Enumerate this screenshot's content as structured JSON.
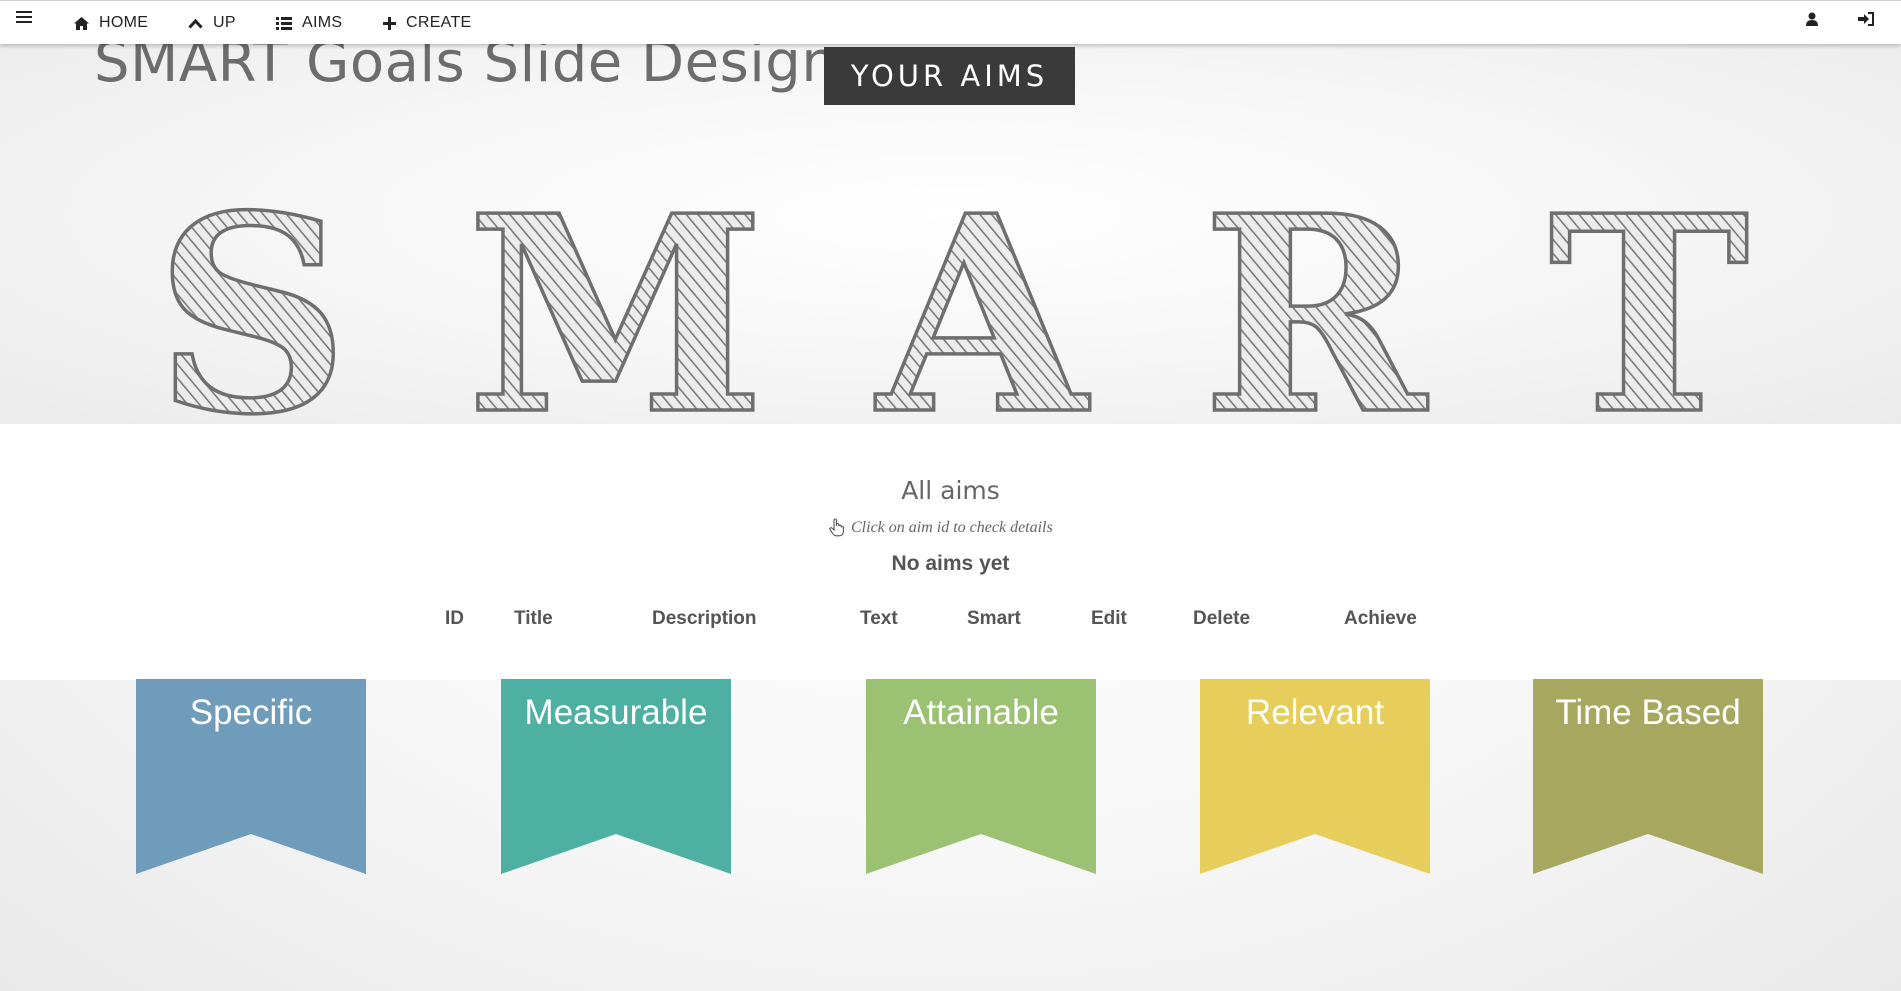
{
  "nav": {
    "home": "HOME",
    "up": "UP",
    "aims": "AIMS",
    "create": "CREATE"
  },
  "hero": {
    "slide_title": "SMART Goals Slide Design",
    "your_aims_button": "YOUR AIMS",
    "letters": [
      "S",
      "M",
      "A",
      "R",
      "T"
    ]
  },
  "aims": {
    "heading": "All aims",
    "hint": "Click on aim id to check details",
    "empty_message": "No aims yet",
    "columns": [
      "ID",
      "Title",
      "Description",
      "Text",
      "Smart",
      "Edit",
      "Delete",
      "Achieve"
    ]
  },
  "ribbons": [
    {
      "label": "Specific",
      "color": "#6f9cbb"
    },
    {
      "label": "Measurable",
      "color": "#4db0a3"
    },
    {
      "label": "Attainable",
      "color": "#9bc272"
    },
    {
      "label": "Relevant",
      "color": "#e6cd5c"
    },
    {
      "label": "Time Based",
      "color": "#a7a85f"
    }
  ],
  "icons": {
    "menu": "hamburger-icon",
    "home": "home-icon",
    "up": "chevron-up-icon",
    "aims": "list-icon",
    "create": "plus-icon",
    "user": "user-icon",
    "login": "sign-in-icon",
    "hint": "hand-pointer-icon"
  }
}
